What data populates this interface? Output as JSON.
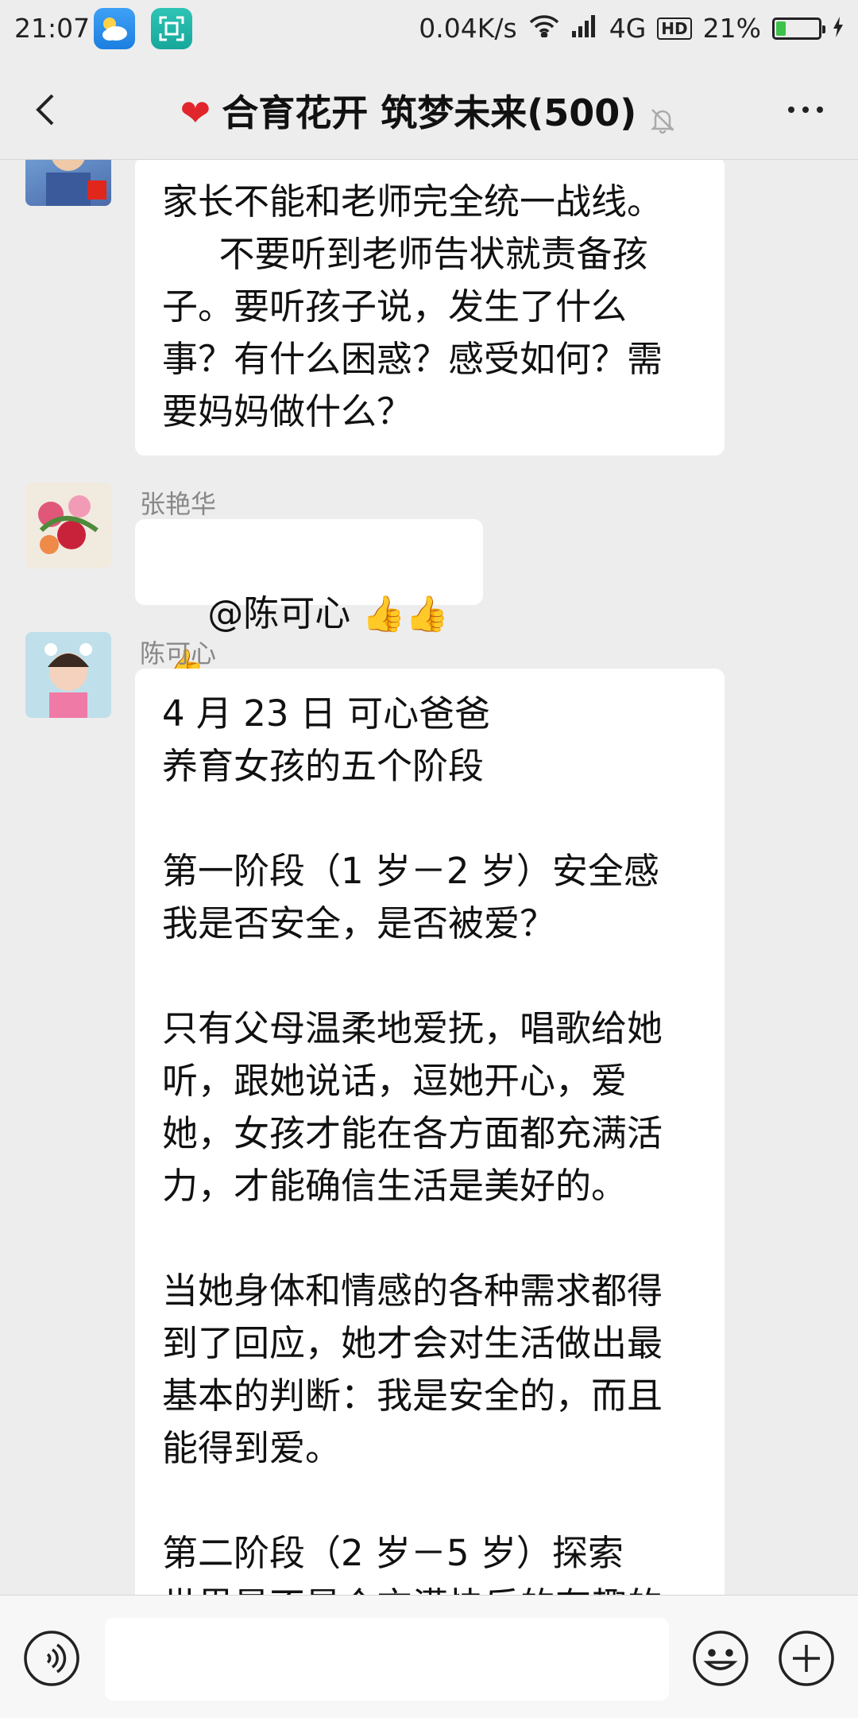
{
  "status_bar": {
    "time": "21:07",
    "net_speed": "0.04K/s",
    "network": "4G",
    "hd": "HD",
    "battery": "21%",
    "battery_level": 0.21,
    "icons": [
      "weather-icon",
      "scan-icon",
      "wifi-icon",
      "signal-icon",
      "hd-icon",
      "battery-icon",
      "charging-icon"
    ]
  },
  "header": {
    "title": "合育花开 筑梦未来(500)",
    "icons": [
      "back-icon",
      "heart-icon",
      "mute-bell-icon",
      "more-icon"
    ]
  },
  "messages": [
    {
      "sender": "",
      "text": "家长不能和老师完全统一战线。\n     不要听到老师告状就责备孩子。要听孩子说，发生了什么事？有什么困惑？感受如何？需要妈妈做什么？"
    },
    {
      "sender": "张艳华",
      "text": "@陈可心 ",
      "emoji": "👍👍👍"
    },
    {
      "sender": "陈可心",
      "text": "4 月 23 日 可心爸爸\n养育女孩的五个阶段\n\n第一阶段（1 岁－2 岁）安全感\n我是否安全，是否被爱？\n\n只有父母温柔地爱抚，唱歌给她听，跟她说话，逗她开心，爱她，女孩才能在各方面都充满活力，才能确信生活是美好的。\n\n当她身体和情感的各种需求都得到了回应，她才会对生活做出最基本的判断：我是安全的，而且能得到爱。\n\n第二阶段（2 岁－5 岁）探索\n世界是不是个充满快乐的有趣的地方？"
    }
  ],
  "input_bar": {
    "placeholder": "",
    "icons": [
      "voice-icon",
      "emoji-icon",
      "plus-icon"
    ]
  },
  "colors": {
    "background": "#ededed",
    "bubble": "#ffffff",
    "heart": "#e0262c",
    "battery_fill": "#3cc24a"
  }
}
